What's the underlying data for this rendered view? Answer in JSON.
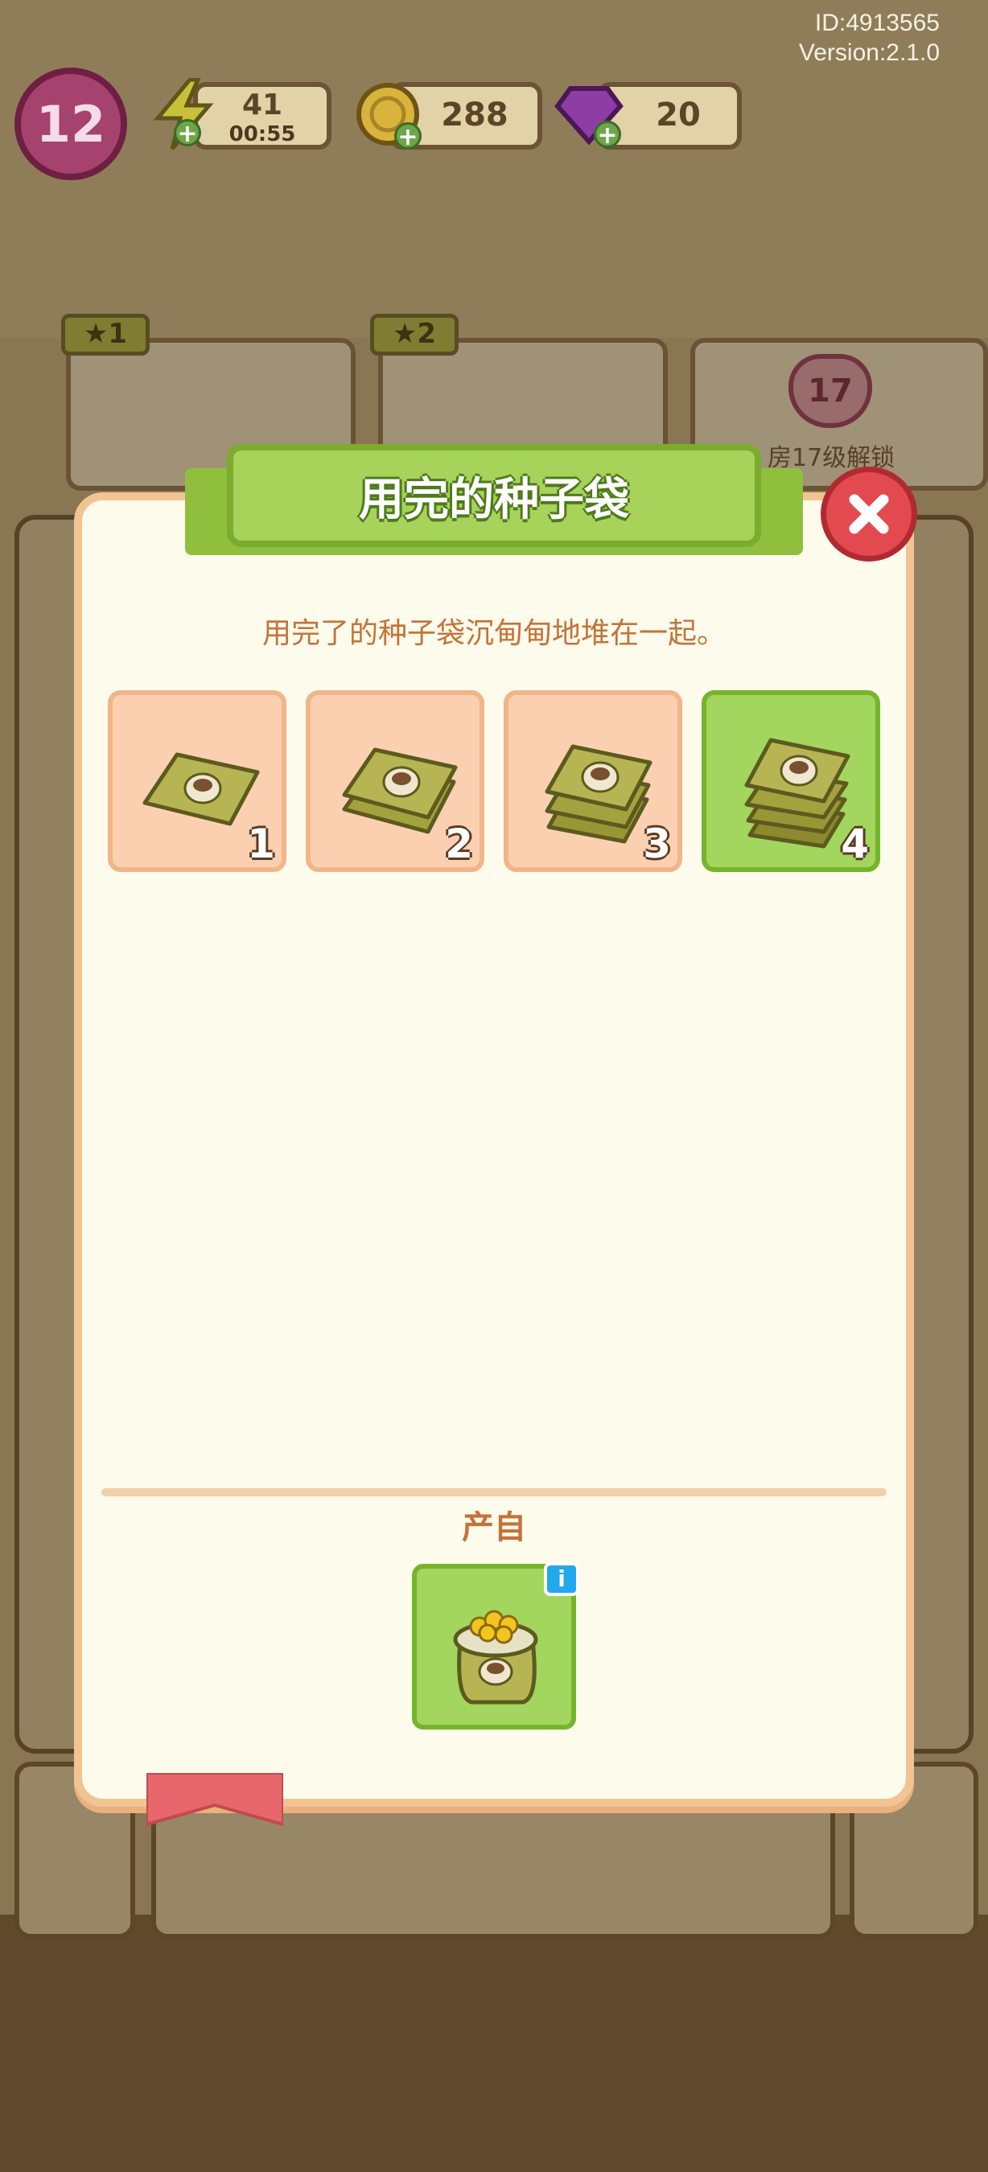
{
  "hud": {
    "user_id": "ID:4913565",
    "version": "Version:2.1.0",
    "level": "12",
    "energy": "41",
    "energy_timer": "00:55",
    "coins": "288",
    "gems": "20"
  },
  "background": {
    "tab1_stars": "1",
    "tab2_stars": "2",
    "tab3_level": "17",
    "tab3_text": "房17级解锁"
  },
  "dialog": {
    "title": "用完的种子袋",
    "description": "用完了的种子袋沉甸甸地堆在一起。",
    "stages": [
      {
        "level": "1",
        "icon": "seed-bag-stack-1-icon"
      },
      {
        "level": "2",
        "icon": "seed-bag-stack-2-icon"
      },
      {
        "level": "3",
        "icon": "seed-bag-stack-3-icon"
      },
      {
        "level": "4",
        "icon": "seed-bag-stack-4-icon"
      }
    ],
    "selected_stage": 4,
    "source_label": "产自",
    "source_icon": "full-seed-sack-icon",
    "info_label": "i"
  },
  "colors": {
    "panel_bg": "#fdfbeb",
    "panel_border": "#f3c493",
    "stage_bg": "#fbd0b0",
    "stage_active_bg": "#a2d65e",
    "banner_green": "#a7d35a",
    "close_red": "#e24a4f",
    "text_orange": "#c3733a"
  }
}
